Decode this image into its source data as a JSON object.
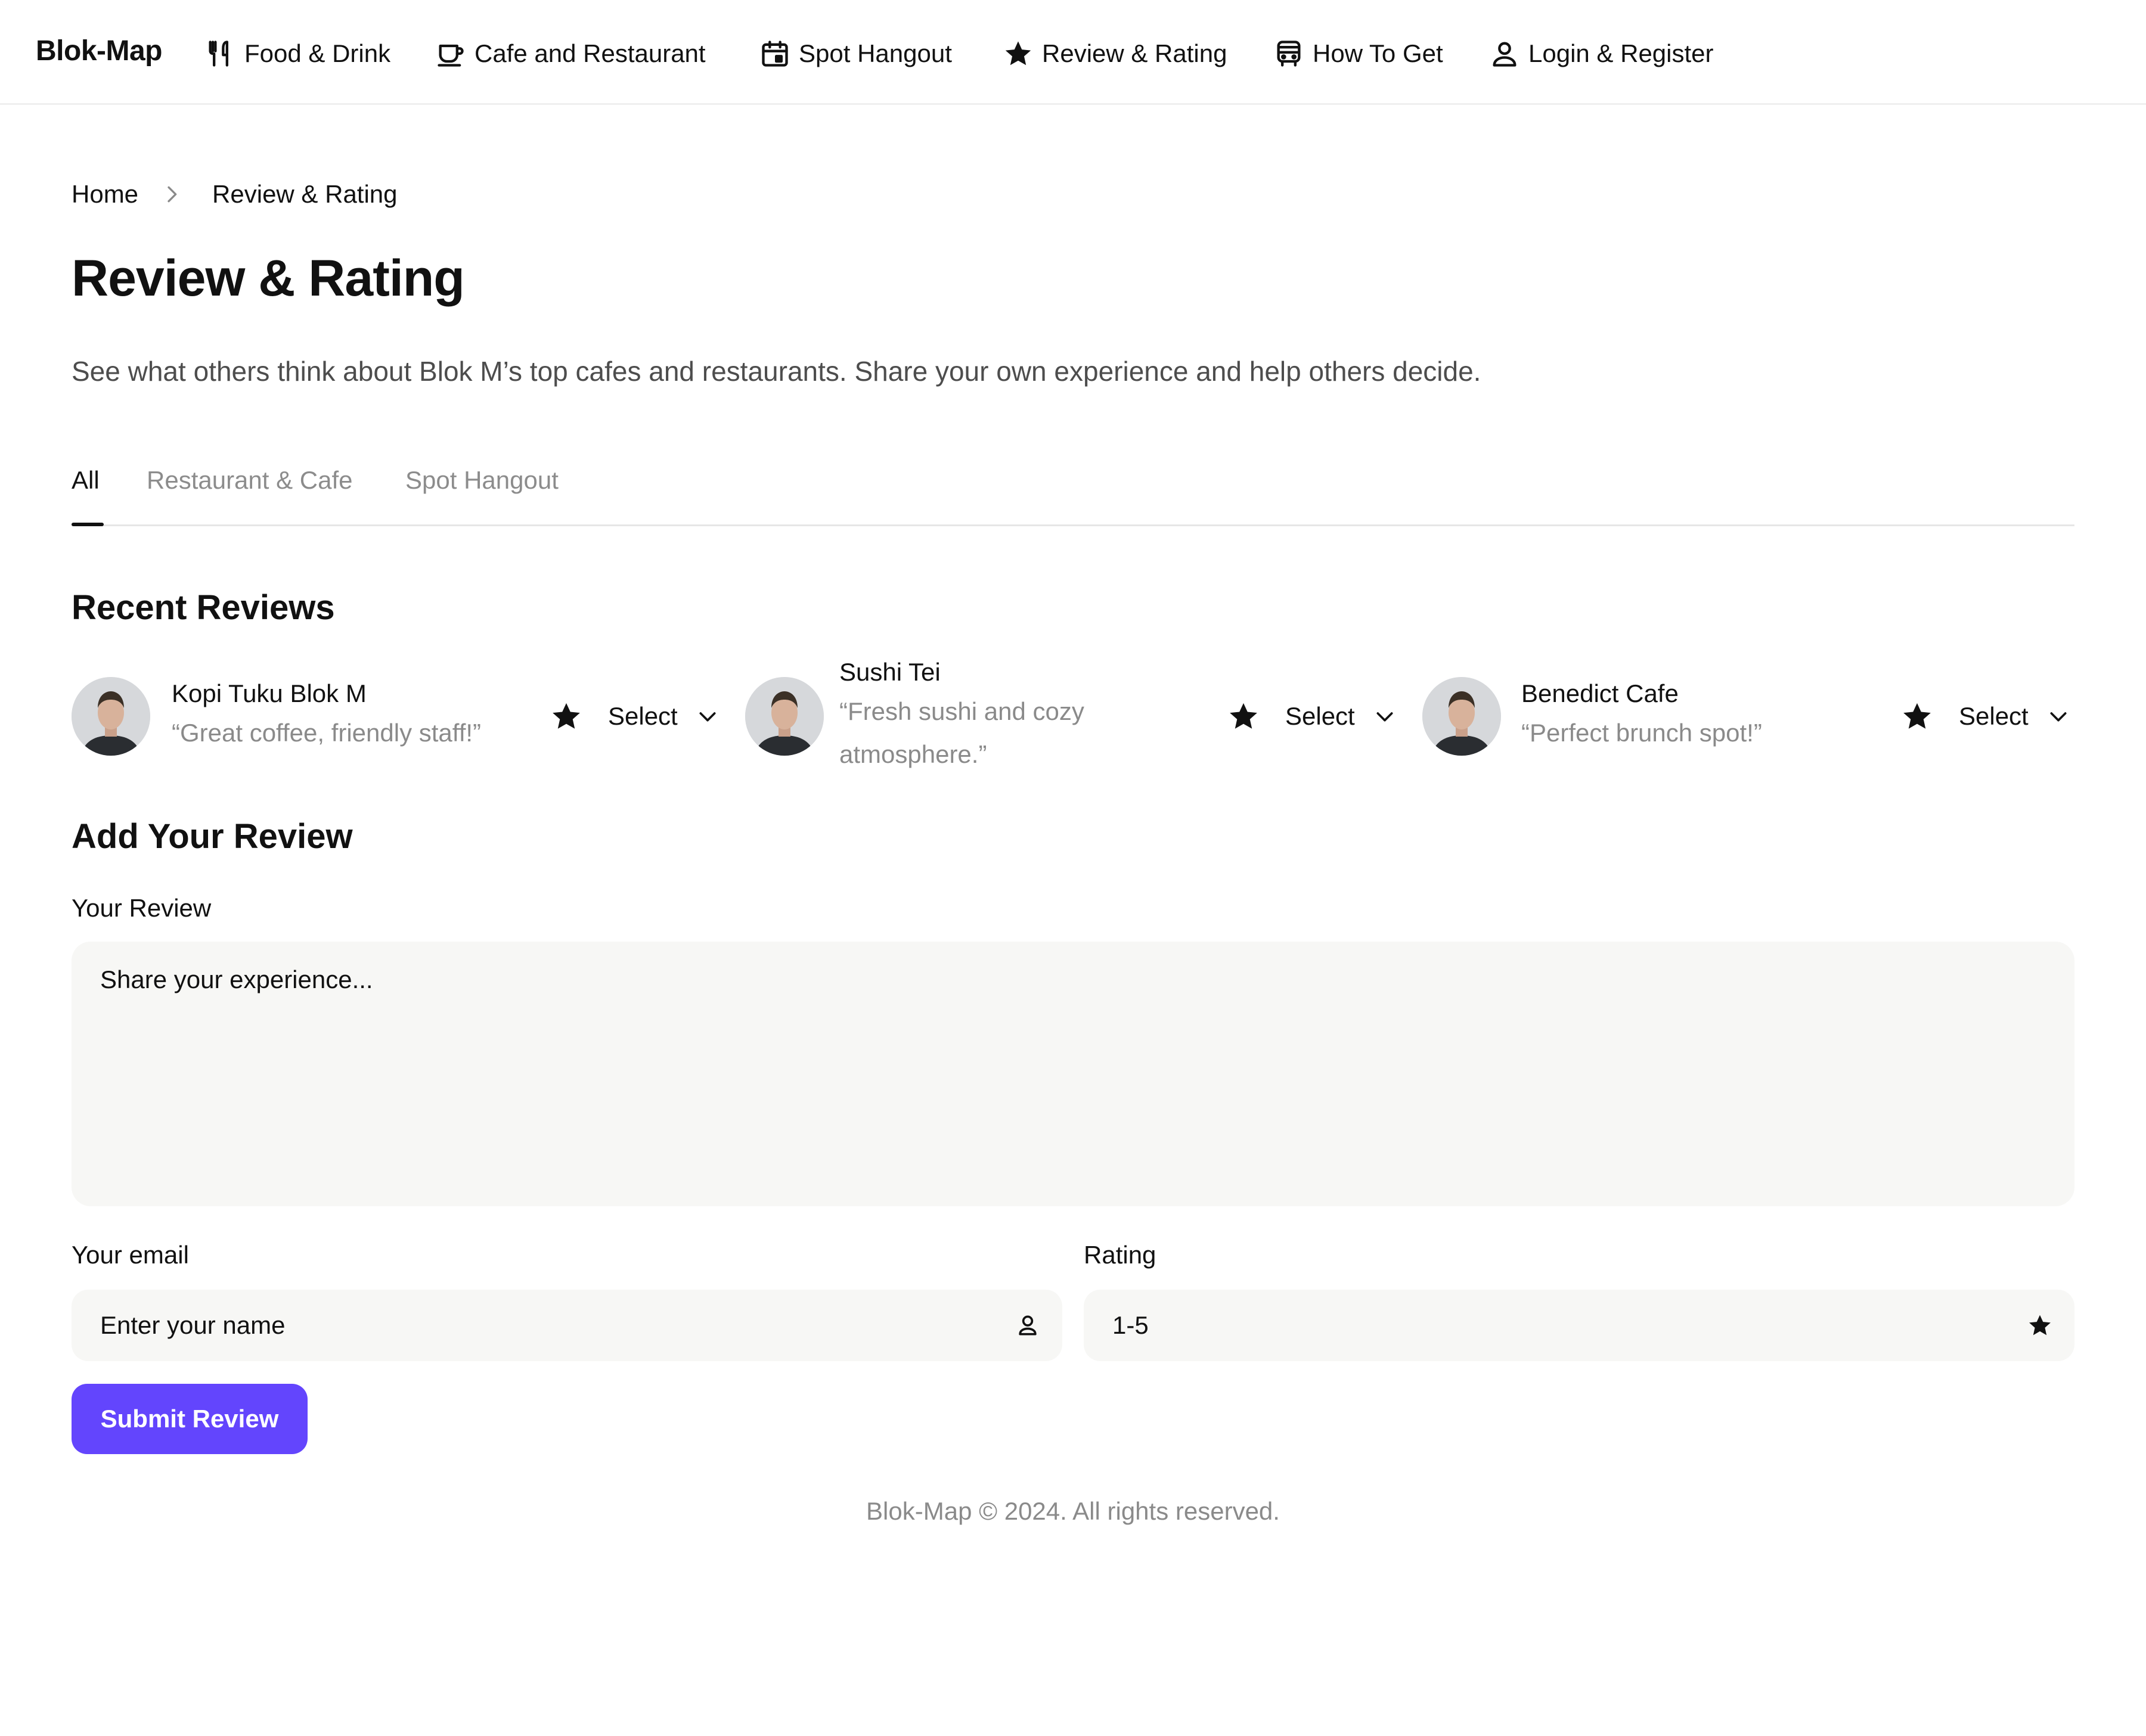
{
  "brand": "Blok-Map",
  "nav": [
    {
      "label": "Food & Drink",
      "icon": "fork-knife-icon"
    },
    {
      "label": "Cafe and Restaurant",
      "icon": "coffee-cup-icon"
    },
    {
      "label": "Spot Hangout",
      "icon": "calendar-icon"
    },
    {
      "label": "Review & Rating",
      "icon": "star-icon"
    },
    {
      "label": "How To Get",
      "icon": "bus-icon"
    },
    {
      "label": "Login & Register",
      "icon": "user-icon"
    }
  ],
  "breadcrumb": {
    "home": "Home",
    "current": "Review & Rating"
  },
  "page": {
    "title": "Review & Rating",
    "subtitle": "See what others think about Blok M’s top cafes and restaurants. Share your own experience and help others decide."
  },
  "tabs": [
    {
      "label": "All",
      "active": true
    },
    {
      "label": "Restaurant & Cafe",
      "active": false
    },
    {
      "label": "Spot Hangout",
      "active": false
    }
  ],
  "recent": {
    "title": "Recent Reviews",
    "items": [
      {
        "name": "Kopi Tuku Blok M",
        "quote": "“Great coffee, friendly staff!”",
        "select_label": "Select"
      },
      {
        "name": "Sushi Tei",
        "quote": "“Fresh sushi and cozy atmosphere.”",
        "select_label": "Select"
      },
      {
        "name": "Benedict Cafe",
        "quote": "“Perfect brunch spot!”",
        "select_label": "Select"
      }
    ]
  },
  "form": {
    "title": "Add Your Review",
    "review_label": "Your Review",
    "review_placeholder": "Share your experience...",
    "email_label": "Your email",
    "email_placeholder": "Enter your name",
    "rating_label": "Rating",
    "rating_placeholder": "1-5",
    "submit_label": "Submit Review"
  },
  "footer": "Blok-Map © 2024. All rights reserved.",
  "colors": {
    "accent": "#6345fd",
    "input_bg": "#f7f7f5"
  }
}
